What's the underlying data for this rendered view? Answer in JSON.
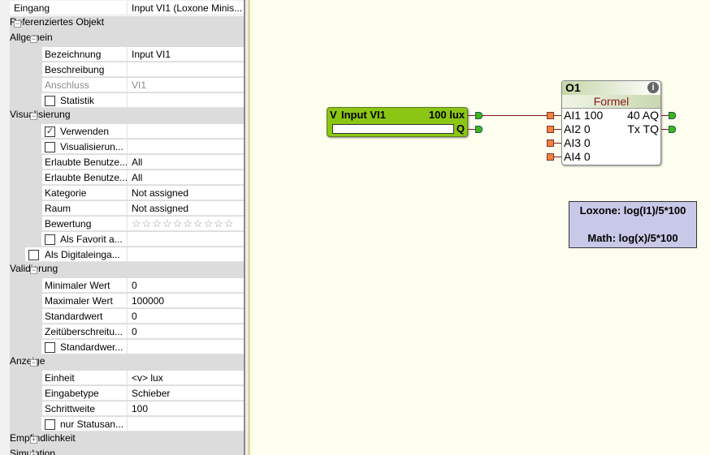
{
  "properties": {
    "rows": [
      {
        "type": "top",
        "label": "Eingang",
        "value": "Input VI1 (Loxone Minis..."
      },
      {
        "type": "head",
        "level": 0,
        "label": "Referenziertes Objekt",
        "expanded": true
      },
      {
        "type": "head",
        "level": 1,
        "label": "Allgemein",
        "expanded": true
      },
      {
        "type": "prop",
        "label": "Bezeichnung",
        "value": "Input VI1"
      },
      {
        "type": "prop",
        "label": "Beschreibung",
        "value": ""
      },
      {
        "type": "prop",
        "label": "Anschluss",
        "value": "VI1",
        "disabled": true
      },
      {
        "type": "check",
        "label": "Statistik",
        "checked": false
      },
      {
        "type": "head",
        "level": 1,
        "label": "Visualisierung",
        "expanded": true
      },
      {
        "type": "check",
        "label": "Verwenden",
        "checked": true
      },
      {
        "type": "check",
        "label": "Visualisierun...",
        "checked": false
      },
      {
        "type": "prop",
        "label": "Erlaubte Benutze...",
        "value": "All"
      },
      {
        "type": "prop",
        "label": "Erlaubte Benutze...",
        "value": "All"
      },
      {
        "type": "prop",
        "label": "Kategorie",
        "value": "Not assigned"
      },
      {
        "type": "prop",
        "label": "Raum",
        "value": "Not assigned"
      },
      {
        "type": "stars",
        "label": "Bewertung",
        "value": "☆☆☆☆☆☆☆☆☆☆"
      },
      {
        "type": "check",
        "label": "Als Favorit a...",
        "checked": false
      },
      {
        "type": "check0",
        "label": "Als Digitaleinga...",
        "checked": false
      },
      {
        "type": "head",
        "level": 1,
        "label": "Validierung",
        "expanded": true
      },
      {
        "type": "prop",
        "label": "Minimaler Wert",
        "value": "0"
      },
      {
        "type": "prop",
        "label": "Maximaler Wert",
        "value": "100000"
      },
      {
        "type": "prop",
        "label": "Standardwert",
        "value": "0"
      },
      {
        "type": "prop",
        "label": "Zeitüberschreitu...",
        "value": "0"
      },
      {
        "type": "check",
        "label": "Standardwer...",
        "checked": false
      },
      {
        "type": "head",
        "level": 1,
        "label": "Anzeige",
        "expanded": true
      },
      {
        "type": "prop",
        "label": "Einheit",
        "value": "<v> lux"
      },
      {
        "type": "prop",
        "label": "Eingabetype",
        "value": "Schieber"
      },
      {
        "type": "prop",
        "label": "Schrittweite",
        "value": "100"
      },
      {
        "type": "check",
        "label": "nur Statusan...",
        "checked": false
      },
      {
        "type": "head",
        "level": 1,
        "label": "Empfindlichkeit",
        "expanded": false
      },
      {
        "type": "head",
        "level": 1,
        "label": "Simulation",
        "expanded": false
      }
    ]
  },
  "canvas": {
    "input_block": {
      "prefix": "V",
      "name": "Input VI1",
      "value": "100 lux",
      "output_q": "Q"
    },
    "formula_block": {
      "id": "O1",
      "type": "Formel",
      "info": "i",
      "inputs": [
        "AI1 100",
        "AI2 0",
        "AI3 0",
        "AI4 0"
      ],
      "outputs": [
        "40 AQ",
        "Tx TQ"
      ]
    },
    "note": {
      "line1": "Loxone: log(I1)/5*100",
      "line2": "Math: log(x)/5*100"
    }
  }
}
